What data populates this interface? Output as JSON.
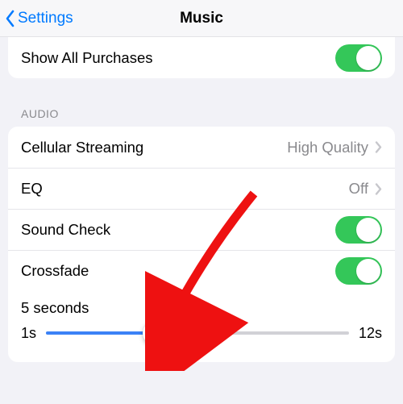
{
  "nav": {
    "back": "Settings",
    "title": "Music"
  },
  "first_group": {
    "show_all": "Show All Purchases"
  },
  "section_label": "AUDIO",
  "audio": {
    "cellular": {
      "label": "Cellular Streaming",
      "value": "High Quality"
    },
    "eq": {
      "label": "EQ",
      "value": "Off"
    },
    "sound_check": "Sound Check",
    "crossfade": "Crossfade",
    "slider": {
      "current": "5 seconds",
      "min": "1s",
      "max": "12s",
      "percent": 36
    }
  }
}
